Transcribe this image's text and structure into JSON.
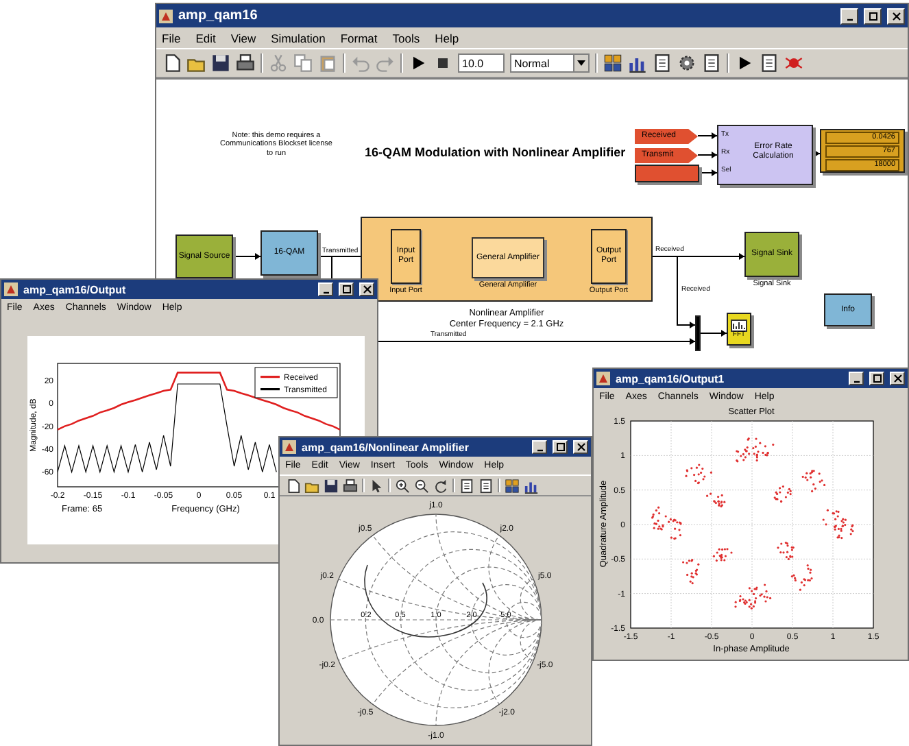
{
  "windows": [
    {
      "kind": "model",
      "title": "amp_qam16",
      "menus": [
        "File",
        "Edit",
        "View",
        "Simulation",
        "Format",
        "Tools",
        "Help"
      ],
      "stop_time": "10.0",
      "sim_mode": "Normal",
      "note": "Note: this demo requires a Communications Blockset license to run",
      "heading": "16-QAM Modulation with Nonlinear Amplifier",
      "blocks": [
        {
          "kind": "tag",
          "label": "Received"
        },
        {
          "kind": "tag",
          "label": "Transmit"
        },
        {
          "kind": "constant"
        },
        {
          "kind": "calc",
          "label": "Error Rate Calculation",
          "ports": [
            "Tx",
            "Rx",
            "Sel"
          ]
        },
        {
          "kind": "display",
          "values": [
            "0.0426",
            "767",
            "18000"
          ]
        },
        {
          "kind": "source",
          "label": "Signal Source"
        },
        {
          "kind": "modulator",
          "label": "16-QAM"
        },
        {
          "kind": "subsystem",
          "caption": [
            "Nonlinear Amplifier",
            "Center Frequency = 2.1 GHz"
          ],
          "children": [
            {
              "kind": "port",
              "label": "Input Port",
              "caption": "Input Port"
            },
            {
              "kind": "amplifier",
              "label": "General Amplifier",
              "caption": "General Amplifier"
            },
            {
              "kind": "port",
              "label": "Output Port",
              "caption": "Output Port"
            }
          ]
        },
        {
          "kind": "sink",
          "label": "Signal Sink",
          "caption": "Signal Sink"
        },
        {
          "kind": "mux"
        },
        {
          "kind": "scope",
          "label": "FFT"
        },
        {
          "kind": "info",
          "label": "Info"
        }
      ],
      "line_labels": [
        "Transmitted",
        "Received",
        "Received",
        "Transmitted"
      ]
    },
    {
      "kind": "spectrum",
      "title": "amp_qam16/Output",
      "menus": [
        "File",
        "Axes",
        "Channels",
        "Window",
        "Help"
      ],
      "frame": "Frame: 65",
      "chart_data": {
        "type": "line",
        "legend": true,
        "xlabel": "Frequency (GHz)",
        "ylabel": "Magnitude, dB",
        "xlim": [
          -0.2,
          0.2
        ],
        "ylim": [
          -73,
          35
        ],
        "xticks": [
          -0.2,
          -0.15,
          -0.1,
          -0.05,
          0,
          0.05,
          0.1
        ],
        "yticks": [
          20,
          0,
          -20,
          -40,
          -60
        ],
        "x": [
          -0.2,
          -0.19,
          -0.18,
          -0.17,
          -0.16,
          -0.15,
          -0.14,
          -0.13,
          -0.12,
          -0.11,
          -0.1,
          -0.09,
          -0.08,
          -0.07,
          -0.06,
          -0.05,
          -0.04,
          -0.03,
          -0.02,
          -0.01,
          0,
          0.01,
          0.02,
          0.03,
          0.04,
          0.05,
          0.06,
          0.07,
          0.08,
          0.09,
          0.1,
          0.11,
          0.12,
          0.13,
          0.14,
          0.15,
          0.16,
          0.17,
          0.18,
          0.19,
          0.2
        ],
        "series": [
          {
            "name": "Received",
            "color": "#e02020",
            "values": [
              -23,
              -20,
              -18,
              -15,
              -13,
              -11,
              -8,
              -6,
              -4,
              -1,
              1,
              3,
              5,
              7,
              9,
              11,
              12,
              27,
              27,
              27,
              27,
              27,
              27,
              27,
              12,
              11,
              9,
              7,
              5,
              3,
              1,
              -1,
              -4,
              -6,
              -8,
              -11,
              -13,
              -15,
              -18,
              -20,
              -23
            ]
          },
          {
            "name": "Transmitted",
            "color": "#000000",
            "values": [
              -60,
              -37,
              -60,
              -37,
              -60,
              -37,
              -60,
              -37,
              -60,
              -37,
              -60,
              -36,
              -60,
              -34,
              -58,
              -28,
              -55,
              17,
              17,
              17,
              17,
              17,
              17,
              17,
              -20,
              -55,
              -28,
              -58,
              -34,
              -60,
              -36,
              -60,
              null,
              null,
              null,
              null,
              null,
              null,
              null,
              null,
              null
            ]
          }
        ]
      }
    },
    {
      "kind": "smith",
      "title": "amp_qam16/Nonlinear Amplifier",
      "menus": [
        "File",
        "Edit",
        "View",
        "Insert",
        "Tools",
        "Window",
        "Help"
      ],
      "edge_labels": [
        "j1.0",
        "j0.5",
        "j2.0",
        "j0.2",
        "j5.0",
        "0.0",
        "-j0.2",
        "-j5.0",
        "-j0.5",
        "-j2.0",
        "-j1.0"
      ],
      "axis_labels": [
        "0.2",
        "0.5",
        "1.0",
        "2.0",
        "5.0"
      ]
    },
    {
      "kind": "scatter",
      "title": "amp_qam16/Output1",
      "menus": [
        "File",
        "Axes",
        "Channels",
        "Window",
        "Help"
      ],
      "plot_title": "Scatter Plot",
      "xlabel": "In-phase Amplitude",
      "ylabel": "Quadrature Amplitude",
      "xticks": [
        "-1.5",
        "-1",
        "-0.5",
        "0",
        "0.5",
        "1",
        "1.5"
      ],
      "yticks": [
        "1.5",
        "1",
        "0.5",
        "0",
        "-0.5",
        "-1",
        "-1.5"
      ]
    }
  ]
}
